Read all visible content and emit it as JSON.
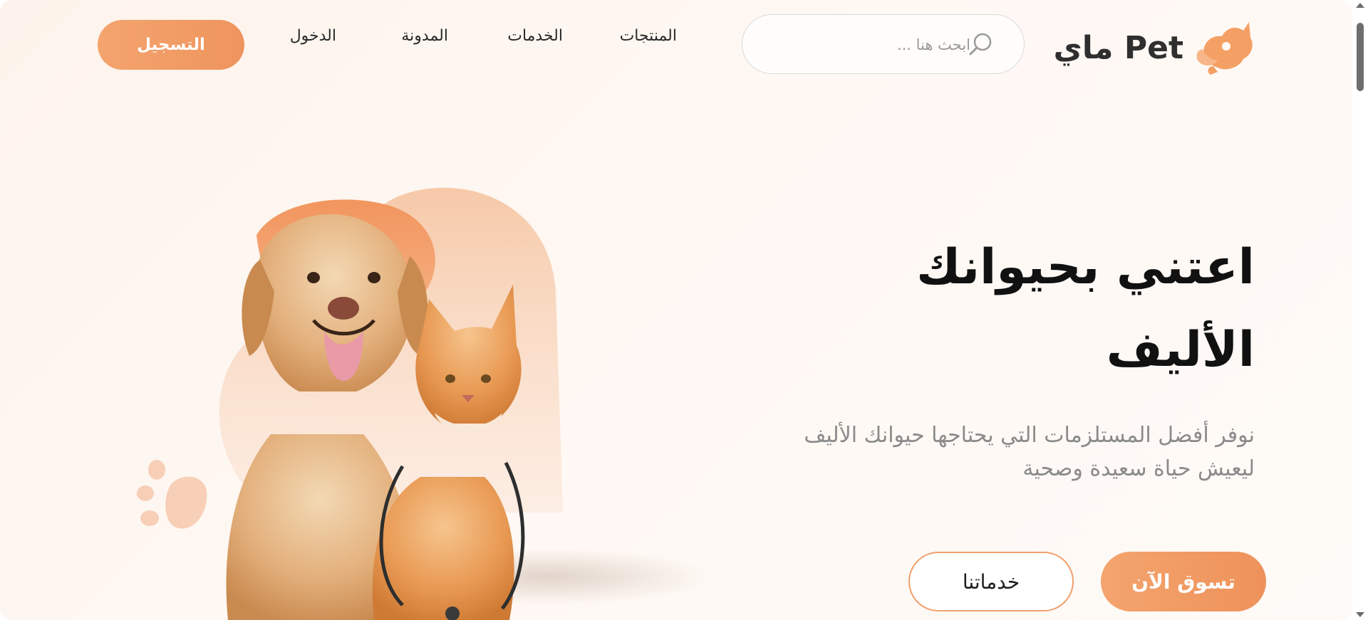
{
  "brand": {
    "name": "ماي Pet",
    "accent": "#f0a06c"
  },
  "search": {
    "placeholder": "ابحث هنا ..."
  },
  "nav": {
    "products": "المنتجات",
    "services": "الخدمات",
    "blog": "المدونة",
    "login": "الدخول",
    "register": "التسجيل"
  },
  "hero": {
    "title": "اعتني بحيوانك الأليف",
    "subtitle": "نوفر  أفضل المستلزمات التي يحتاجها حيوانك الأليف ليعيش حياة سعيدة وصحية",
    "shop_label": "تسوق الآن",
    "services_label": "خدماتنا"
  },
  "icons": [
    "logo-icon",
    "search-icon",
    "paw-icon"
  ]
}
